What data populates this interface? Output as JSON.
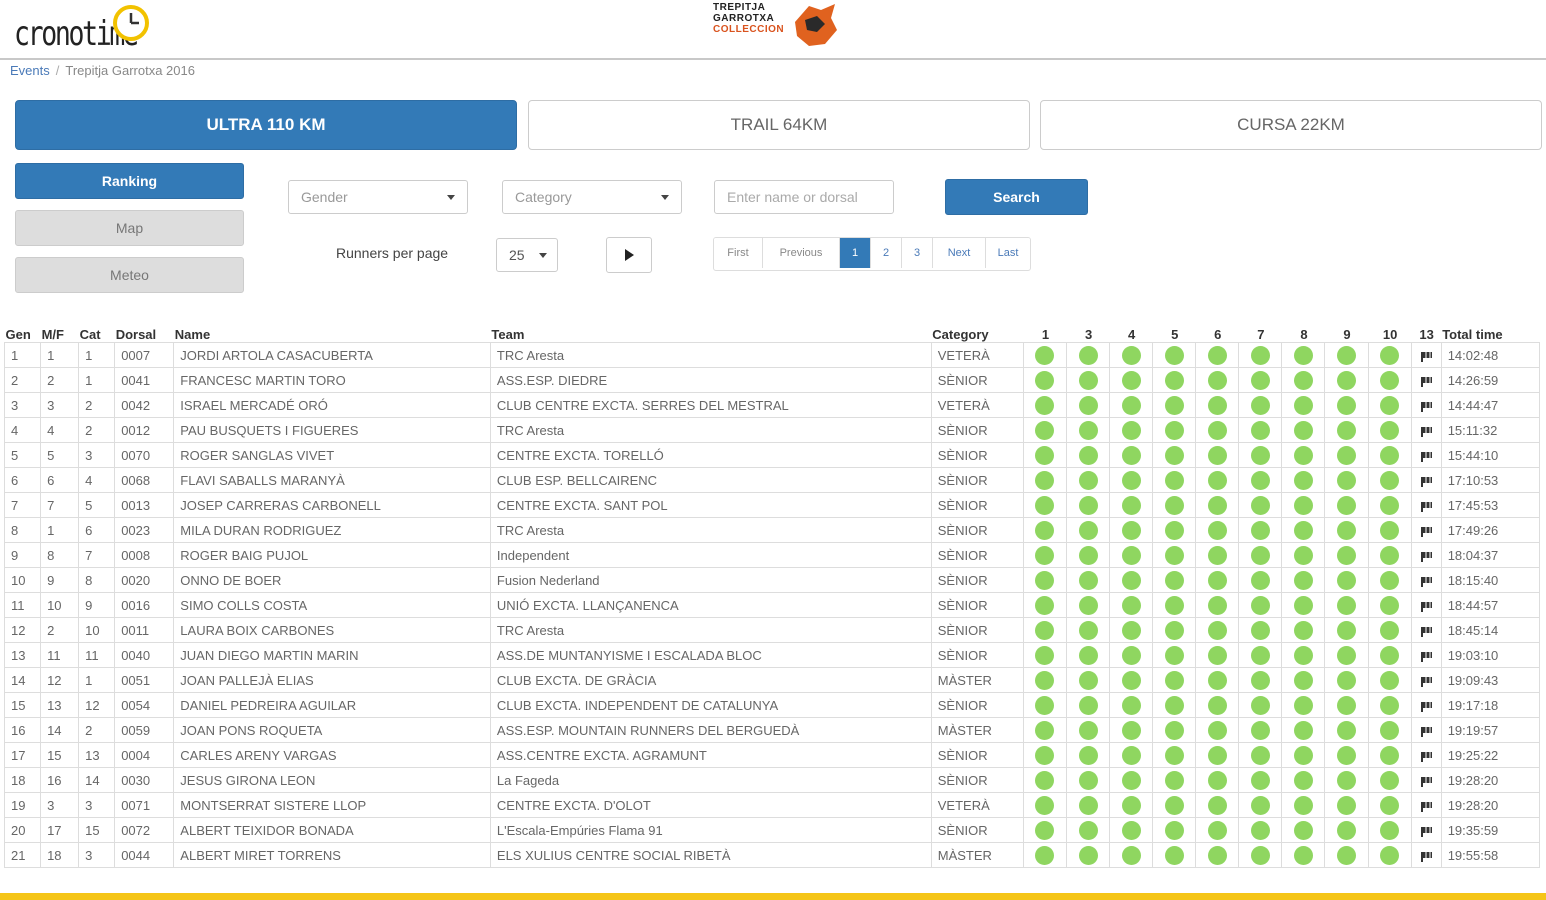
{
  "header": {
    "logo_text": "cronotime",
    "event_logo_lines": [
      "TREPITJA",
      "GARROTXA",
      "COLLECCION"
    ]
  },
  "breadcrumb": {
    "root": "Events",
    "current": "Trepitja Garrotxa 2016"
  },
  "race_tabs": [
    {
      "label": "ULTRA 110 KM",
      "active": true
    },
    {
      "label": "TRAIL 64KM",
      "active": false
    },
    {
      "label": "CURSA 22KM",
      "active": false
    }
  ],
  "side_menu": [
    {
      "label": "Ranking",
      "active": true
    },
    {
      "label": "Map",
      "active": false
    },
    {
      "label": "Meteo",
      "active": false
    }
  ],
  "filters": {
    "gender": "Gender",
    "category": "Category",
    "search_placeholder": "Enter name or dorsal",
    "search_label": "Search",
    "runners_per_page_label": "Runners per page",
    "runners_per_page_value": "25"
  },
  "pagination": {
    "first": "First",
    "previous": "Previous",
    "pages": [
      "1",
      "2",
      "3"
    ],
    "current": "1",
    "next": "Next",
    "last": "Last"
  },
  "table": {
    "columns": [
      "Gen",
      "M/F",
      "Cat",
      "Dorsal",
      "Name",
      "Team",
      "Category",
      "1",
      "3",
      "4",
      "5",
      "6",
      "7",
      "8",
      "9",
      "10",
      "13",
      "Total time"
    ],
    "checkpoints": [
      "1",
      "3",
      "4",
      "5",
      "6",
      "7",
      "8",
      "9",
      "10"
    ],
    "rows": [
      [
        "1",
        "1",
        "1",
        "0007",
        "JORDI ARTOLA CASACUBERTA",
        "TRC Aresta",
        "VETERÀ",
        "14:02:48"
      ],
      [
        "2",
        "2",
        "1",
        "0041",
        "FRANCESC MARTIN TORO",
        "ASS.ESP. DIEDRE",
        "SÈNIOR",
        "14:26:59"
      ],
      [
        "3",
        "3",
        "2",
        "0042",
        "ISRAEL MERCADÉ ORÓ",
        "CLUB CENTRE EXCTA. SERRES DEL MESTRAL",
        "VETERÀ",
        "14:44:47"
      ],
      [
        "4",
        "4",
        "2",
        "0012",
        "PAU BUSQUETS I FIGUERES",
        "TRC Aresta",
        "SÈNIOR",
        "15:11:32"
      ],
      [
        "5",
        "5",
        "3",
        "0070",
        "ROGER SANGLAS VIVET",
        "CENTRE EXCTA. TORELLÓ",
        "SÈNIOR",
        "15:44:10"
      ],
      [
        "6",
        "6",
        "4",
        "0068",
        "FLAVI SABALLS MARANYÀ",
        "CLUB ESP. BELLCAIRENC",
        "SÈNIOR",
        "17:10:53"
      ],
      [
        "7",
        "7",
        "5",
        "0013",
        "JOSEP CARRERAS CARBONELL",
        "CENTRE EXCTA. SANT POL",
        "SÈNIOR",
        "17:45:53"
      ],
      [
        "8",
        "1",
        "6",
        "0023",
        "MILA DURAN RODRIGUEZ",
        "TRC Aresta",
        "SÈNIOR",
        "17:49:26"
      ],
      [
        "9",
        "8",
        "7",
        "0008",
        "ROGER BAIG PUJOL",
        "Independent",
        "SÈNIOR",
        "18:04:37"
      ],
      [
        "10",
        "9",
        "8",
        "0020",
        "ONNO DE BOER",
        "Fusion Nederland",
        "SÈNIOR",
        "18:15:40"
      ],
      [
        "11",
        "10",
        "9",
        "0016",
        "SIMO COLLS COSTA",
        "UNIÓ EXCTA. LLANÇANENCA",
        "SÈNIOR",
        "18:44:57"
      ],
      [
        "12",
        "2",
        "10",
        "0011",
        "LAURA BOIX CARBONES",
        "TRC Aresta",
        "SÈNIOR",
        "18:45:14"
      ],
      [
        "13",
        "11",
        "11",
        "0040",
        "JUAN DIEGO MARTIN MARIN",
        "ASS.DE MUNTANYISME I ESCALADA BLOC",
        "SÈNIOR",
        "19:03:10"
      ],
      [
        "14",
        "12",
        "1",
        "0051",
        "JOAN PALLEJÀ ELIAS",
        "CLUB EXCTA. DE GRÀCIA",
        "MÀSTER",
        "19:09:43"
      ],
      [
        "15",
        "13",
        "12",
        "0054",
        "DANIEL PEDREIRA AGUILAR",
        "CLUB EXCTA. INDEPENDENT DE CATALUNYA",
        "SÈNIOR",
        "19:17:18"
      ],
      [
        "16",
        "14",
        "2",
        "0059",
        "JOAN PONS ROQUETA",
        "ASS.ESP. MOUNTAIN RUNNERS DEL BERGUEDÀ",
        "MÀSTER",
        "19:19:57"
      ],
      [
        "17",
        "15",
        "13",
        "0004",
        "CARLES ARENY VARGAS",
        "ASS.CENTRE EXCTA. AGRAMUNT",
        "SÈNIOR",
        "19:25:22"
      ],
      [
        "18",
        "16",
        "14",
        "0030",
        "JESUS GIRONA LEON",
        "La Fageda",
        "SÈNIOR",
        "19:28:20"
      ],
      [
        "19",
        "3",
        "3",
        "0071",
        "MONTSERRAT SISTERE LLOP",
        "CENTRE EXCTA. D'OLOT",
        "VETERÀ",
        "19:28:20"
      ],
      [
        "20",
        "17",
        "15",
        "0072",
        "ALBERT TEIXIDOR BONADA",
        "L'Escala-Empúries Flama 91",
        "SÈNIOR",
        "19:35:59"
      ],
      [
        "21",
        "18",
        "3",
        "0044",
        "ALBERT MIRET TORRENS",
        "ELS XULIUS CENTRE SOCIAL RIBETÀ",
        "MÀSTER",
        "19:55:58"
      ]
    ]
  },
  "colors": {
    "primary": "#337ab7",
    "checkpoint_dot": "#8fd660",
    "bottom_bar": "#f5c518"
  },
  "icons": {
    "checkpoint": "green-dot-icon",
    "finish": "finish-flag-icon",
    "play": "play-icon",
    "dropdown": "caret-down-icon"
  }
}
